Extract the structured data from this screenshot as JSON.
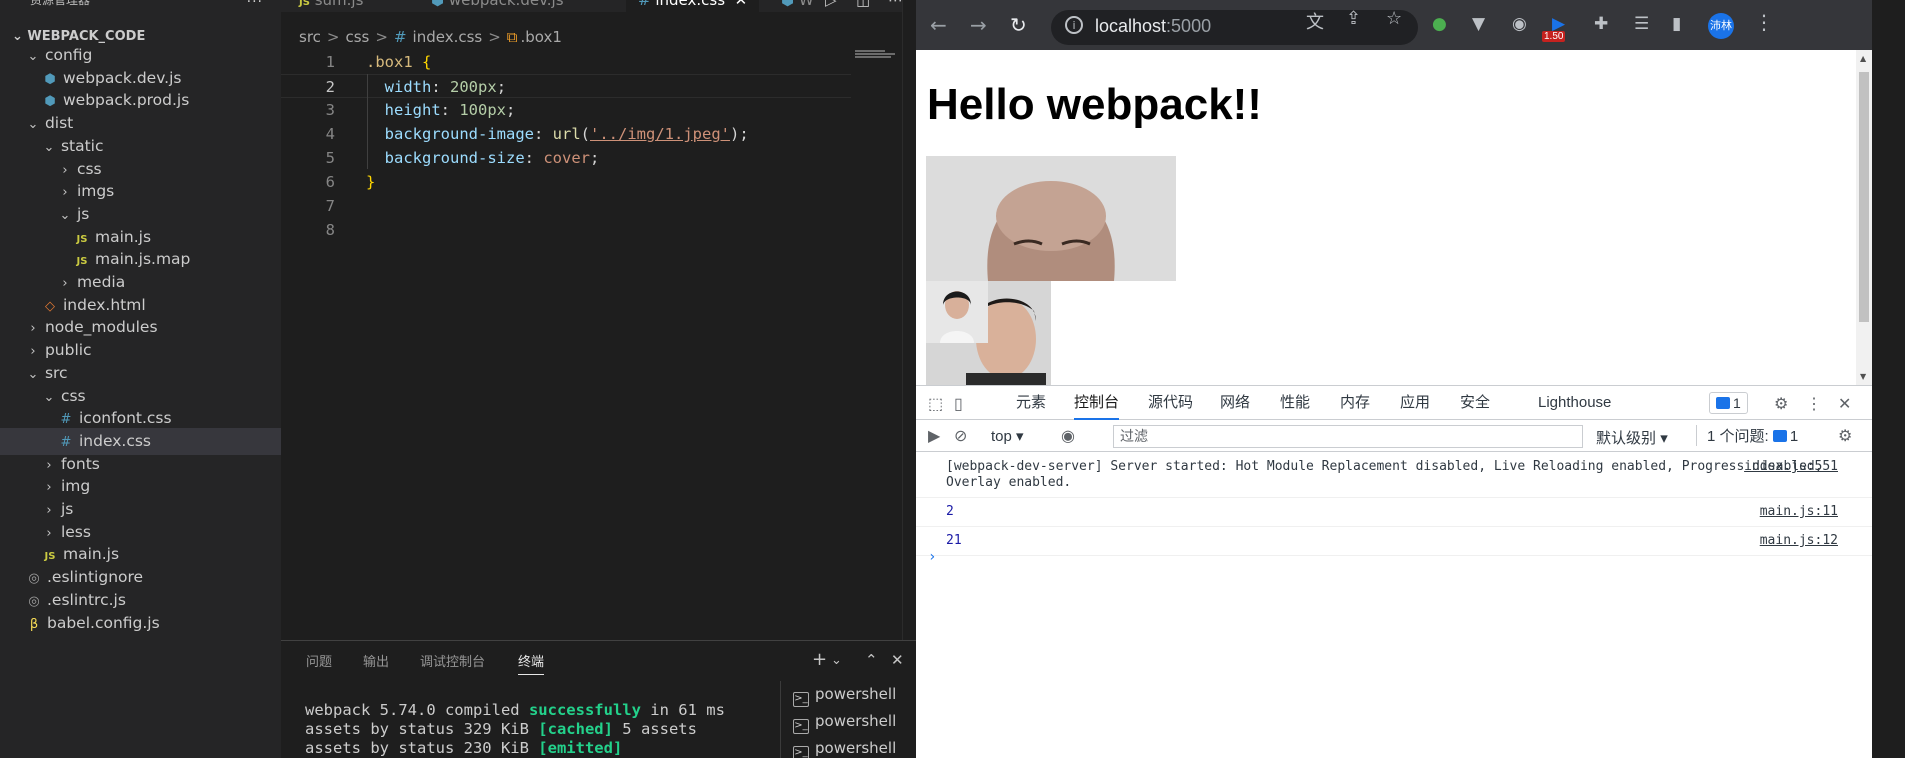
{
  "vscode": {
    "explorer_title": "资源管理器",
    "root": "WEBPACK_CODE",
    "tree": [
      {
        "label": "config",
        "type": "folder",
        "open": true,
        "depth": 1
      },
      {
        "label": "webpack.dev.js",
        "type": "cfg",
        "depth": 2
      },
      {
        "label": "webpack.prod.js",
        "type": "cfg",
        "depth": 2
      },
      {
        "label": "dist",
        "type": "folder",
        "open": true,
        "depth": 1
      },
      {
        "label": "static",
        "type": "folder",
        "open": true,
        "depth": 2
      },
      {
        "label": "css",
        "type": "folder",
        "open": false,
        "depth": 3
      },
      {
        "label": "imgs",
        "type": "folder",
        "open": false,
        "depth": 3
      },
      {
        "label": "js",
        "type": "folder",
        "open": true,
        "depth": 3
      },
      {
        "label": "main.js",
        "type": "js",
        "depth": 4
      },
      {
        "label": "main.js.map",
        "type": "js",
        "depth": 4
      },
      {
        "label": "media",
        "type": "folder",
        "open": false,
        "depth": 3
      },
      {
        "label": "index.html",
        "type": "html",
        "depth": 2
      },
      {
        "label": "node_modules",
        "type": "folder",
        "open": false,
        "depth": 1
      },
      {
        "label": "public",
        "type": "folder",
        "open": false,
        "depth": 1
      },
      {
        "label": "src",
        "type": "folder",
        "open": true,
        "depth": 1
      },
      {
        "label": "css",
        "type": "folder",
        "open": true,
        "depth": 2
      },
      {
        "label": "iconfont.css",
        "type": "css",
        "depth": 3
      },
      {
        "label": "index.css",
        "type": "css",
        "depth": 3,
        "selected": true
      },
      {
        "label": "fonts",
        "type": "folder",
        "open": false,
        "depth": 2
      },
      {
        "label": "img",
        "type": "folder",
        "open": false,
        "depth": 2
      },
      {
        "label": "js",
        "type": "folder",
        "open": false,
        "depth": 2
      },
      {
        "label": "less",
        "type": "folder",
        "open": false,
        "depth": 2
      },
      {
        "label": "main.js",
        "type": "js",
        "depth": 2
      },
      {
        "label": ".eslintignore",
        "type": "gear",
        "depth": 1
      },
      {
        "label": ".eslintrc.js",
        "type": "gear",
        "depth": 1
      },
      {
        "label": "babel.config.js",
        "type": "babel",
        "depth": 1
      }
    ],
    "tabs": {
      "sum": "sum.js",
      "webpack_dev": "webpack.dev.js",
      "index_css": "index.css",
      "partial": "W"
    },
    "breadcrumb": {
      "a": "src",
      "b": "css",
      "c": "index.css",
      "d": ".box1"
    },
    "code": {
      "line_numbers": [
        "1",
        "2",
        "3",
        "4",
        "5",
        "6",
        "7",
        "8"
      ],
      "selector": ".box1",
      "open_brace": "{",
      "close_brace": "}",
      "width_prop": "width",
      "width_val": "200px",
      "height_prop": "height",
      "height_val": "100px",
      "bg_prop": "background-image",
      "bg_fn": "url",
      "bg_path": "'../img/1.jpeg'",
      "bgsize_prop": "background-size",
      "bgsize_val": "cover"
    },
    "panel": {
      "tabs": [
        "问题",
        "输出",
        "调试控制台",
        "终端"
      ],
      "terminal_line1_a": "webpack 5.74.0 compiled ",
      "terminal_line1_b": "successfully",
      "terminal_line1_c": " in 61 ms",
      "terminal_line2_a": "assets by status 329 KiB ",
      "terminal_line2_b": "[cached]",
      "terminal_line2_c": " 5 assets",
      "terminal_line3_a": "assets by status 230 KiB ",
      "terminal_line3_b": "[emitted]",
      "terminal_list": [
        "powershell",
        "powershell",
        "powershell"
      ]
    }
  },
  "chrome": {
    "url_host": "localhost",
    "url_port": ":5000",
    "profile_name": "沛林",
    "ext_badge": "1.50",
    "page": {
      "heading": "Hello webpack!!"
    },
    "devtools": {
      "tabs": [
        "元素",
        "控制台",
        "源代码",
        "网络",
        "性能",
        "内存",
        "应用",
        "安全",
        "Lighthouse"
      ],
      "issues_count": "1",
      "context": "top",
      "filter_placeholder": "过滤",
      "level": "默认级别",
      "issues_label": "1 个问题:",
      "issues_label_count": "1",
      "console": [
        {
          "text": "[webpack-dev-server] Server started: Hot Module Replacement disabled, Live Reloading enabled, Progress disabled, Overlay enabled.",
          "src": "index.js:551"
        },
        {
          "text": "2",
          "src": "main.js:11"
        },
        {
          "text": "21",
          "src": "main.js:12"
        }
      ],
      "prompt": "›"
    }
  }
}
